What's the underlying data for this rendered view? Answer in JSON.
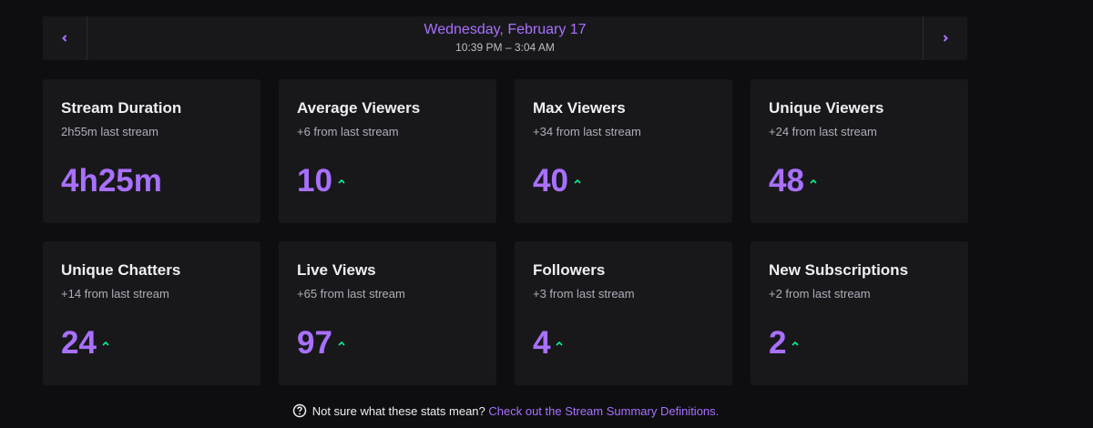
{
  "date_nav": {
    "title": "Wednesday, February 17",
    "time_range": "10:39 PM – 3:04 AM",
    "prev_icon": "chevron-left-icon",
    "next_icon": "chevron-right-icon"
  },
  "colors": {
    "background": "#0e0e10",
    "card": "#18181b",
    "accent": "#a970ff",
    "trend_up": "#00f593"
  },
  "cards": [
    {
      "title": "Stream Duration",
      "subtitle": "2h55m last stream",
      "value": "4h25m",
      "trend": ""
    },
    {
      "title": "Average Viewers",
      "subtitle": "+6 from last stream",
      "value": "10",
      "trend": "up"
    },
    {
      "title": "Max Viewers",
      "subtitle": "+34 from last stream",
      "value": "40",
      "trend": "up"
    },
    {
      "title": "Unique Viewers",
      "subtitle": "+24 from last stream",
      "value": "48",
      "trend": "up"
    },
    {
      "title": "Unique Chatters",
      "subtitle": "+14 from last stream",
      "value": "24",
      "trend": "up"
    },
    {
      "title": "Live Views",
      "subtitle": "+65 from last stream",
      "value": "97",
      "trend": "up"
    },
    {
      "title": "Followers",
      "subtitle": "+3 from last stream",
      "value": "4",
      "trend": "up"
    },
    {
      "title": "New Subscriptions",
      "subtitle": "+2 from last stream",
      "value": "2",
      "trend": "up"
    }
  ],
  "footer": {
    "text": "Not sure what these stats mean?",
    "link": "Check out the Stream Summary Definitions."
  }
}
